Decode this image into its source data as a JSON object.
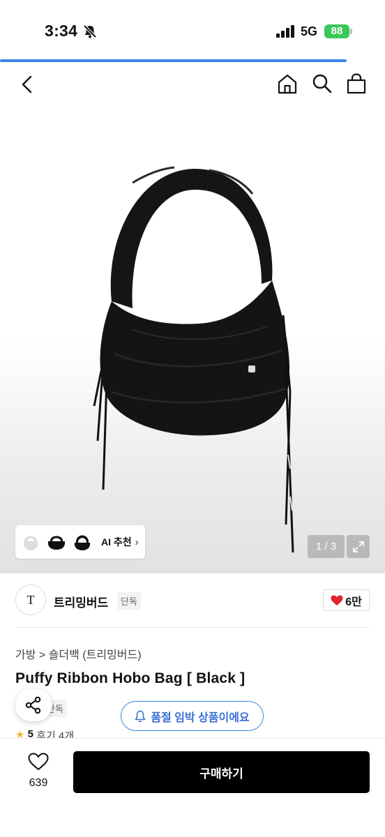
{
  "status_bar": {
    "time": "3:34",
    "network": "5G",
    "battery": "88"
  },
  "header": {
    "icons": [
      "back-icon",
      "home-icon",
      "search-icon",
      "shopping-bag-icon"
    ]
  },
  "hero": {
    "ai_recommend_label": "AI 추천",
    "page_indicator": "1 / 3"
  },
  "shop": {
    "logo_text": "T",
    "name": "트리밍버드",
    "badge": "단독",
    "like_count": "6만"
  },
  "product": {
    "breadcrumb": "가방 > 숄더백 (트리밍버드)",
    "title": "Puffy Ribbon Hobo Bag [ Black ]",
    "exclusive_badge": "단독",
    "rating": "5",
    "review_text": "후기 4개"
  },
  "notice": {
    "soldout_text": "품절 임박 상품이에요"
  },
  "bottom": {
    "wish_count": "639",
    "buy_label": "구매하기"
  },
  "colors": {
    "accent_blue": "#3a86ea",
    "heart_red": "#e0242b",
    "battery_green": "#3bc75a"
  },
  "progress": {
    "fraction": 0.9
  }
}
